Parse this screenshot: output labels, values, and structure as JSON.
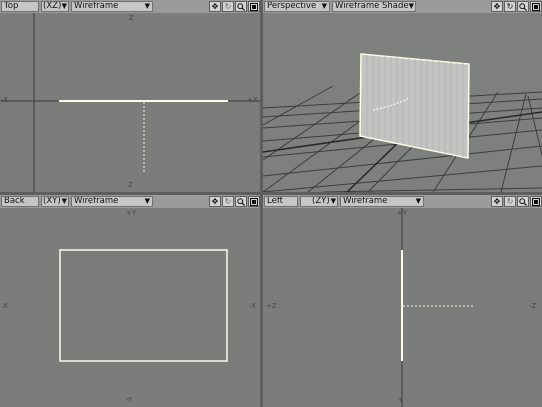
{
  "colors": {
    "viewport_bg": "#7a7d79",
    "grid_line": "#353735",
    "geometry": "#fdfde8",
    "toolbar": "#9a9c99"
  },
  "viewports": {
    "top_left": {
      "view": "Top",
      "axis": "(XZ)",
      "mode": "Wireframe",
      "labels": {
        "top": "Z",
        "bottom": "Z",
        "left": "-X",
        "right": "+X"
      }
    },
    "top_right": {
      "view": "Perspective",
      "mode": "Wireframe Shade"
    },
    "bottom_left": {
      "view": "Back",
      "axis": "(XY)",
      "mode": "Wireframe",
      "labels": {
        "top": "+Y",
        "bottom": "-Y",
        "left": "X",
        "right": "-X"
      }
    },
    "bottom_right": {
      "view": "Left",
      "axis": "(ZY)",
      "mode": "Wireframe",
      "labels": {
        "top": "+Y",
        "bottom": "-Y",
        "left": "+Z",
        "right": "-Z"
      }
    }
  },
  "icons": [
    "move-view-icon",
    "rotate-view-icon",
    "zoom-icon",
    "maximize-icon"
  ]
}
